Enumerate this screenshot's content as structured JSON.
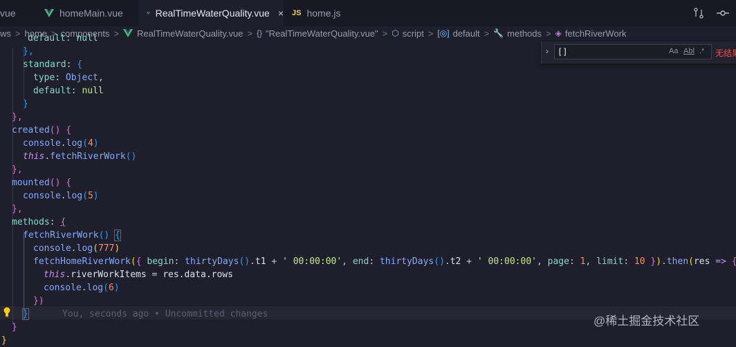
{
  "tabs": [
    {
      "label": "vue",
      "icon": "vue-icon"
    },
    {
      "label": "homeMain.vue",
      "icon": "vue-icon"
    },
    {
      "label": "RealTimeWaterQuality.vue",
      "icon": "vue-icon",
      "active": true
    },
    {
      "label": "home.js",
      "icon": "js-icon",
      "icon_text": "JS"
    }
  ],
  "tab_close": "×",
  "breadcrumb": {
    "items": [
      "ws",
      "home",
      "components",
      "RealTimeWaterQuality.vue",
      "\"RealTimeWaterQuality.vue\"",
      "script",
      "default",
      "methods",
      "fetchRiverWork"
    ],
    "separator": ">",
    "icons": {
      "braces": "{}",
      "script": "⬡",
      "default": "[◎]",
      "methods": "🔧",
      "fetch": "◈"
    }
  },
  "find_widget": {
    "value": "[]",
    "option_case": "Aa",
    "option_word": "Abl",
    "option_regex": ".*",
    "result": "无结果"
  },
  "code": {
    "line_partial": "default: null",
    "l1_brace": "},",
    "l2_prop": "standard",
    "l3_key": "type",
    "l3_val": "Object",
    "l4_key": "default",
    "l4_val": "null",
    "l5": "}",
    "l6": "},",
    "l7_name": "created",
    "l8_obj": "console",
    "l8_fn": "log",
    "l8_arg": "4",
    "l9_this": "this",
    "l9_fn": "fetchRiverWork",
    "l10": "},",
    "l11_name": "mounted",
    "l12_obj": "console",
    "l12_fn": "log",
    "l12_arg": "5",
    "l13": "},",
    "l14_name": "methods",
    "l15_name": "fetchRiverWork",
    "l16_obj": "console",
    "l16_fn": "log",
    "l16_arg": "777",
    "l17_fn": "fetchHomeRiverWork",
    "l17_begin": "begin",
    "l17_td1": "thirtyDays",
    "l17_t1": "t1",
    "l17_str1": "' 00:00:00'",
    "l17_end": "end",
    "l17_td2": "thirtyDays",
    "l17_t2": "t2",
    "l17_str2": "' 00:00:00'",
    "l17_page": "page",
    "l17_page_val": "1",
    "l17_limit": "limit",
    "l17_limit_val": "10",
    "l17_then": "then",
    "l17_res": "res",
    "l18_this": "this",
    "l18_prop": "riverWorkItems",
    "l18_rhs": "res.data.rows",
    "l19_obj": "console",
    "l19_fn": "log",
    "l19_arg": "6",
    "l20": "})",
    "l21": "}",
    "blame": "You, seconds ago • Uncommitted changes",
    "l22": "}",
    "l23": "}"
  },
  "watermark": "@稀土掘金技术社区",
  "colors": {
    "background": "#1f1f2b",
    "keyword": "#c792ea",
    "string": "#c3e88d",
    "number": "#f78c6c",
    "function": "#82aaff"
  }
}
